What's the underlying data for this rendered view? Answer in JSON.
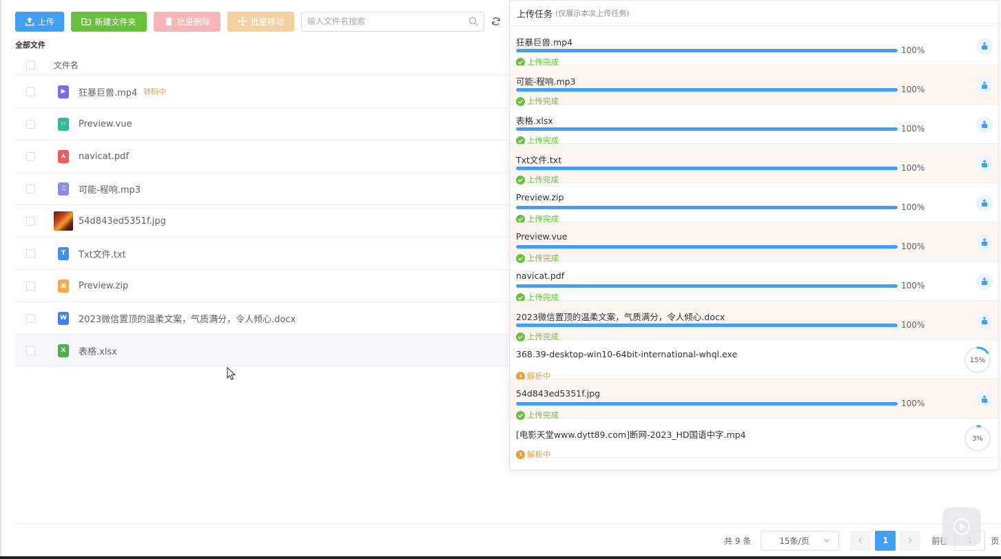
{
  "toolbar": {
    "upload_label": "上传",
    "new_folder_label": "新建文件夹",
    "batch_delete_label": "批量删除",
    "batch_move_label": "批量移动",
    "search_placeholder": "输入文件名搜索"
  },
  "breadcrumb": "全部文件",
  "table": {
    "header_name": "文件名",
    "rows": [
      {
        "name": "狂暴巨兽.mp4",
        "status": "转码中",
        "icon": "video-file-icon",
        "color": "#7c6cf0"
      },
      {
        "name": "Preview.vue",
        "status": "",
        "icon": "code-file-icon",
        "color": "#2bbf9a"
      },
      {
        "name": "navicat.pdf",
        "status": "",
        "icon": "pdf-file-icon",
        "color": "#f25b5b"
      },
      {
        "name": "可能-程响.mp3",
        "status": "",
        "icon": "audio-file-icon",
        "color": "#8a8af7"
      },
      {
        "name": "54d843ed5351f.jpg",
        "status": "",
        "icon": "image-thumbnail",
        "color": "#c8421a"
      },
      {
        "name": "Txt文件.txt",
        "status": "",
        "icon": "txt-file-icon",
        "color": "#3d8ef8"
      },
      {
        "name": "Preview.zip",
        "status": "",
        "icon": "zip-file-icon",
        "color": "#f7a94a"
      },
      {
        "name": "2023微信置顶的温柔文案，气质满分，令人倾心.docx",
        "status": "",
        "icon": "word-file-icon",
        "color": "#3b82f6"
      },
      {
        "name": "表格.xlsx",
        "status": "",
        "icon": "excel-file-icon",
        "color": "#4cb050"
      }
    ]
  },
  "upload_panel": {
    "title": "上传任务",
    "subtitle": "(仅展示本次上传任务)",
    "tasks": [
      {
        "name": "狂暴巨兽.mp4",
        "progress": 100,
        "pct_label": "100%",
        "status": "上传完成",
        "state": "done"
      },
      {
        "name": "可能-程响.mp3",
        "progress": 100,
        "pct_label": "100%",
        "status": "上传完成",
        "state": "done"
      },
      {
        "name": "表格.xlsx",
        "progress": 100,
        "pct_label": "100%",
        "status": "上传完成",
        "state": "done"
      },
      {
        "name": "Txt文件.txt",
        "progress": 100,
        "pct_label": "100%",
        "status": "上传完成",
        "state": "done"
      },
      {
        "name": "Preview.zip",
        "progress": 100,
        "pct_label": "100%",
        "status": "上传完成",
        "state": "done"
      },
      {
        "name": "Preview.vue",
        "progress": 100,
        "pct_label": "100%",
        "status": "上传完成",
        "state": "done"
      },
      {
        "name": "navicat.pdf",
        "progress": 100,
        "pct_label": "100%",
        "status": "上传完成",
        "state": "done"
      },
      {
        "name": "2023微信置顶的温柔文案，气质满分，令人倾心.docx",
        "progress": 100,
        "pct_label": "100%",
        "status": "上传完成",
        "state": "done"
      },
      {
        "name": "368.39-desktop-win10-64bit-international-whql.exe",
        "progress": 15,
        "pct_label": "15%",
        "status": "解析中",
        "state": "parsing"
      },
      {
        "name": "54d843ed5351f.jpg",
        "progress": 100,
        "pct_label": "100%",
        "status": "上传完成",
        "state": "done"
      },
      {
        "name": "[电影天堂www.dytt89.com]断网-2023_HD国语中字.mp4",
        "progress": 3,
        "pct_label": "3%",
        "status": "解析中",
        "state": "parsing"
      }
    ]
  },
  "pagination": {
    "total": "共 9 条",
    "page_size": "15条/页",
    "current_page": "1",
    "goto_label": "前往",
    "goto_value": "1",
    "page_unit": "页"
  },
  "colors": {
    "primary": "#409eff",
    "success": "#67c23a",
    "warning": "#e6a23c",
    "danger_light": "#fab6b6",
    "warning_light": "#f3d19e"
  }
}
